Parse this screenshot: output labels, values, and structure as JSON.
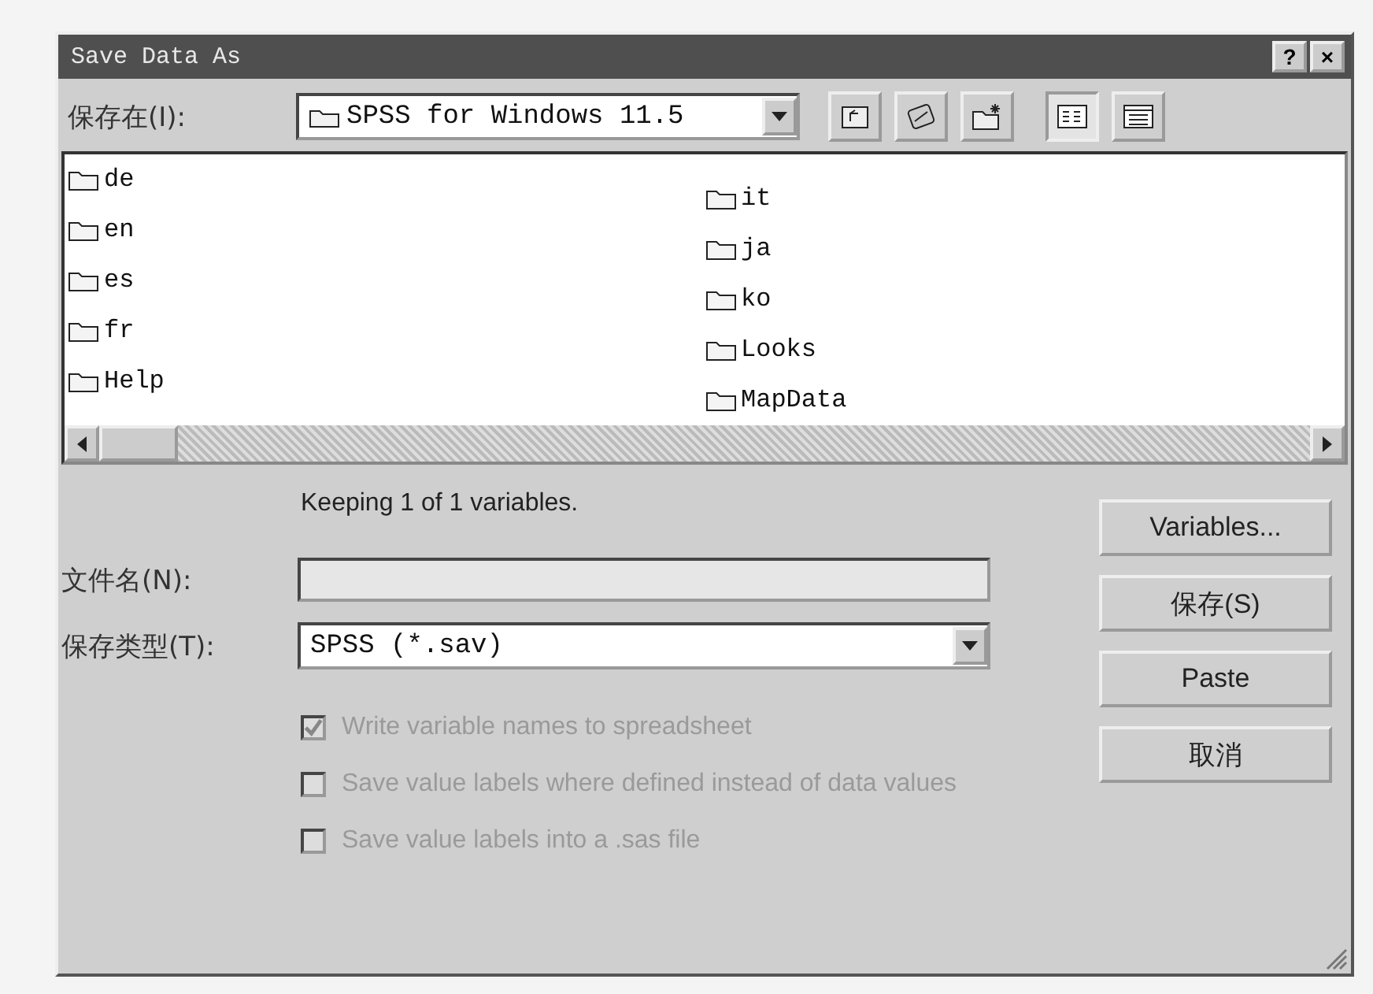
{
  "window": {
    "title": "Save Data As",
    "controls": [
      "?",
      "×"
    ]
  },
  "look_in": {
    "label": "保存在(I):",
    "value": "SPSS for Windows 11.5"
  },
  "files": [
    {
      "name": "de"
    },
    {
      "name": "en"
    },
    {
      "name": "es"
    },
    {
      "name": "fr"
    },
    {
      "name": "Help"
    },
    {
      "name": "it"
    },
    {
      "name": "ja"
    },
    {
      "name": "ko"
    },
    {
      "name": "Looks"
    },
    {
      "name": "MapData"
    }
  ],
  "status": "Keeping 1 of 1 variables.",
  "file_name": {
    "label": "文件名(N):"
  },
  "file_type": {
    "label": "保存类型(T):",
    "value": "SPSS (*.sav)"
  },
  "buttons": [
    "Variables...",
    "保存(S)",
    "Paste",
    "取消"
  ],
  "options": [
    {
      "label": "Write variable names to spreadsheet",
      "checked": true,
      "disabled": true
    },
    {
      "label": "Save value labels where defined instead of data values",
      "checked": false,
      "disabled": true
    },
    {
      "label": "Save value labels into a .sas file",
      "checked": false,
      "disabled": true
    }
  ]
}
